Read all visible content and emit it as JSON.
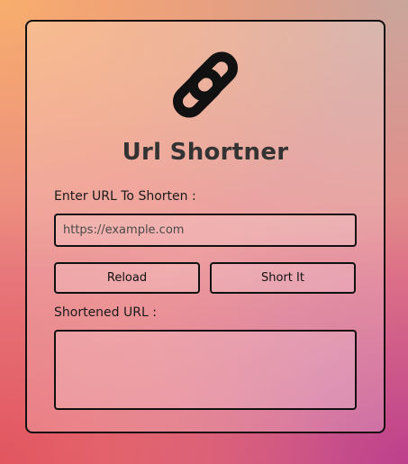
{
  "app": {
    "title": "Url Shortner",
    "logo_icon": "link-icon"
  },
  "form": {
    "input_label": "Enter URL To Shorten :",
    "input_value": "",
    "input_placeholder": "https://example.com",
    "reload_label": "Reload",
    "short_label": "Short It",
    "output_label": "Shortened URL :",
    "output_value": ""
  },
  "colors": {
    "border": "#111111",
    "title_text": "#333333",
    "bg_top_left": "#f7ae6d",
    "bg_top_right": "#caa69b",
    "bg_bottom_left": "#e2555f",
    "bg_bottom_right": "#bd3f8c"
  }
}
